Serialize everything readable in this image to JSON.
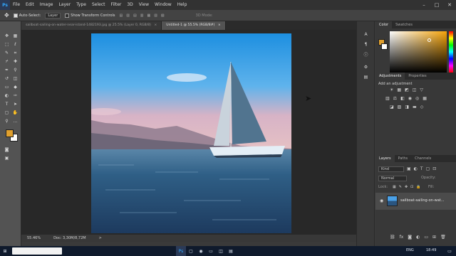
{
  "menubar": {
    "logo": "Ps",
    "items": [
      "File",
      "Edit",
      "Image",
      "Layer",
      "Type",
      "Select",
      "Filter",
      "3D",
      "View",
      "Window",
      "Help"
    ]
  },
  "options": {
    "auto_select": "Auto-Select:",
    "auto_select_target": "Layer",
    "show_transform": "Show Transform Controls",
    "mode_3d": "3D Mode:"
  },
  "tabs": [
    {
      "label": "sailboat-sailing-on-water-near-island-1482193.jpg @ 25.5% (Layer 0, RGB/8)",
      "close": "×"
    },
    {
      "label": "Untitled-1 @ 55.5% (RGB/8#)",
      "close": "×"
    }
  ],
  "status": {
    "zoom": "55.46%",
    "doc": "Doc: 3,30M/8,72M",
    "arrow": ">"
  },
  "panels": {
    "color_tabs": [
      "Color",
      "Swatches"
    ],
    "adjust_tabs": [
      "Adjustments",
      "Properties"
    ],
    "adjust_label": "Add an adjustment",
    "layers_tabs": [
      "Layers",
      "Paths",
      "Channels"
    ],
    "kind_label": "Kind",
    "blend_mode": "Normal",
    "opacity_label": "Opacity:",
    "lock_label": "Lock:",
    "fill_label": "Fill:",
    "layer_name": "sailboat-sailing-on-wat..."
  },
  "taskbar": {
    "lang": "ENG",
    "time": "18:49"
  },
  "colors": {
    "foreground": "#e0a02e",
    "background": "#ffffff",
    "accent": "#31a8ff"
  }
}
